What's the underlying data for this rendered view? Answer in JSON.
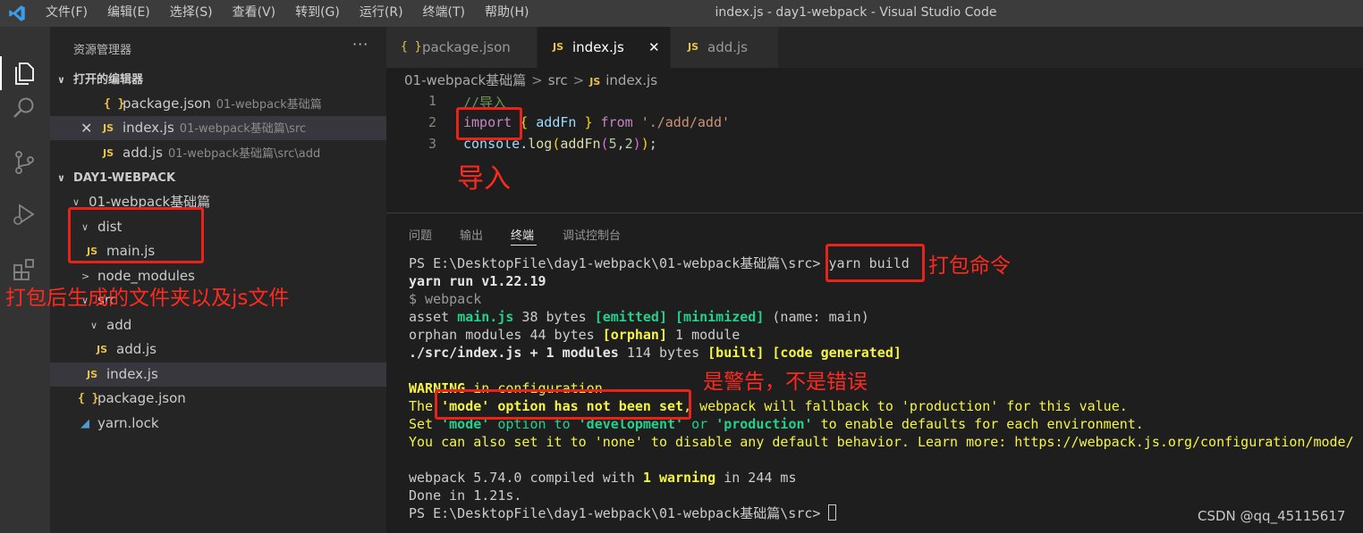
{
  "titlebar": {
    "menu": [
      "文件(F)",
      "编辑(E)",
      "选择(S)",
      "查看(V)",
      "转到(G)",
      "运行(R)",
      "终端(T)",
      "帮助(H)"
    ],
    "window_title": "index.js - day1-webpack - Visual Studio Code"
  },
  "activitybar": {
    "icons": [
      "explorer-icon",
      "search-icon",
      "source-control-icon",
      "run-debug-icon",
      "extensions-icon"
    ]
  },
  "sidebar": {
    "title": "资源管理器",
    "more": "···",
    "open_editors": {
      "header": "打开的编辑器",
      "items": [
        {
          "icon": "{ }",
          "name": "package.json",
          "desc": "01-webpack基础篇"
        },
        {
          "icon": "JS",
          "name": "index.js",
          "desc": "01-webpack基础篇\\src"
        },
        {
          "icon": "JS",
          "name": "add.js",
          "desc": "01-webpack基础篇\\src\\add"
        }
      ]
    },
    "workspace": {
      "header": "DAY1-WEBPACK",
      "tree": {
        "root": "01-webpack基础篇",
        "dist": "dist",
        "main_js": "main.js",
        "node_modules": "node_modules",
        "src": "src",
        "add": "add",
        "add_js": "add.js",
        "index_js": "index.js",
        "package_json": "package.json",
        "yarn_lock": "yarn.lock"
      }
    }
  },
  "tabs": [
    {
      "icon": "{ }",
      "label": "package.json"
    },
    {
      "icon": "JS",
      "label": "index.js",
      "close": "✕"
    },
    {
      "icon": "JS",
      "label": "add.js"
    }
  ],
  "breadcrumb": {
    "folder": "01-webpack基础篇",
    "sub": "src",
    "icon": "JS",
    "file": "index.js"
  },
  "code": {
    "line_numbers": [
      "1",
      "2",
      "3"
    ],
    "line1": "//导入",
    "line2": {
      "kw": "import",
      "open": "{",
      "ident": "addFn",
      "close": "}",
      "from": "from",
      "str": "'./add/add'"
    },
    "line3": {
      "obj": "console",
      "dot": ".",
      "method": "log",
      "p1": "(",
      "fn": "addFn",
      "p2": "(",
      "n1": "5",
      "comma": ",",
      "n2": "2",
      "p3": ")",
      "p4": ")",
      "semi": ";"
    }
  },
  "panel": {
    "tabs": [
      "问题",
      "输出",
      "终端",
      "调试控制台"
    ],
    "active_tab": "终端"
  },
  "terminal": {
    "prompt": "PS E:\\DesktopFile\\day1-webpack\\01-webpack基础篇\\src>",
    "command": "yarn build",
    "l2": "yarn run v1.22.19",
    "l3": "$ webpack",
    "l4": {
      "a": "asset ",
      "b": "main.js",
      "c": " 38 bytes ",
      "d": "[emitted]",
      "e": " ",
      "f": "[minimized]",
      "g": " (name: main)"
    },
    "l5": {
      "a": "orphan modules 44 bytes ",
      "b": "[orphan]",
      "c": " 1 module"
    },
    "l6": {
      "a": "./src/index.js + 1 modules",
      "b": " 114 bytes ",
      "c": "[built]",
      "d": " ",
      "e": "[code generated]"
    },
    "l7": {
      "a": "WARNING",
      "b": " in configuration"
    },
    "l8": {
      "a": "The ",
      "b": "'mode' option has not been set",
      "c": ", webpack will fallback to 'production' for this value."
    },
    "l9": {
      "a": "Set ",
      "b": "'mode'",
      "c": " option to ",
      "d": "'development'",
      "e": " or ",
      "f": "'production'",
      "g": " to enable defaults for each environment."
    },
    "l10": "You can also set it to 'none' to disable any default behavior. Learn more: https://webpack.js.org/configuration/mode/",
    "l11": {
      "a": "webpack 5.74.0 compiled with ",
      "b": "1 warning",
      "c": " in 244 ms"
    },
    "l12": "Done in 1.21s."
  },
  "annotations": {
    "import_note": "导入",
    "dist_note": "打包后生成的文件夹以及js文件",
    "build_note": "打包命令",
    "warning_note": "是警告，不是错误"
  },
  "watermark": "CSDN @qq_45115617",
  "colors": {
    "annotation_red": "#e8231a",
    "terminal_green": "#23d18b",
    "terminal_yellow": "#f5f543"
  }
}
